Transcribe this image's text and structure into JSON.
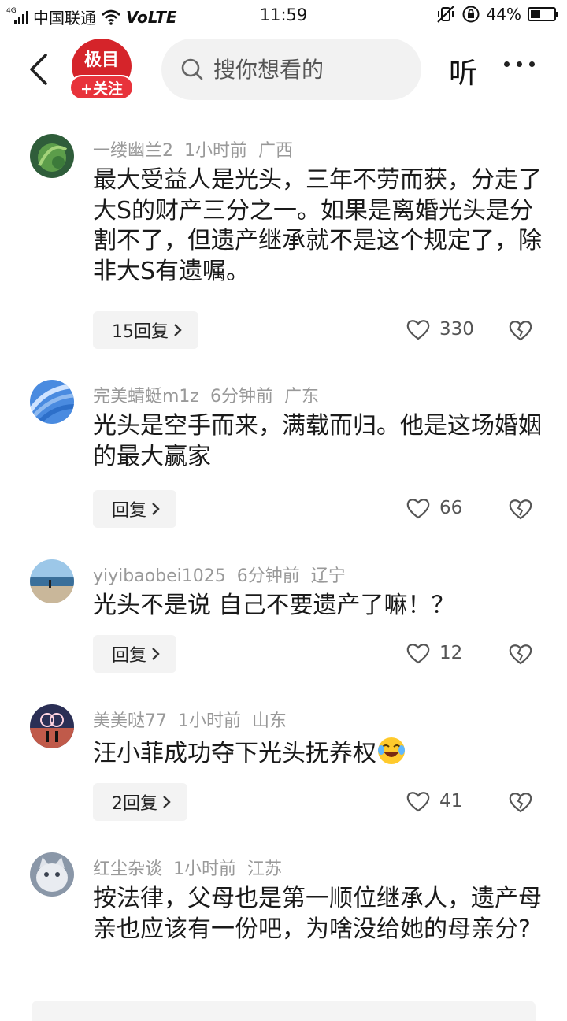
{
  "status_bar": {
    "network_type": "4G",
    "carrier": "中国联通",
    "volte": "VoLTE",
    "time": "11:59",
    "battery_percent": "44%",
    "battery_level": 0.44
  },
  "header": {
    "logo_text": "极目",
    "follow_label": "+关注",
    "search_placeholder": "搜你想看的",
    "listen_label": "听"
  },
  "comments": [
    {
      "username": "一缕幽兰2",
      "time": "1小时前",
      "location": "广西",
      "text": "最大受益人是光头，三年不劳而获，分走了大S的财产三分之一。如果是离婚光头是分割不了，但遗产继承就不是这个规定了，除非大S有遗嘱。",
      "reply_label": "15回复",
      "likes": "330",
      "avatar_icon": "leaf-avatar"
    },
    {
      "username": "完美蜻蜓m1z",
      "time": "6分钟前",
      "location": "广东",
      "text": "光头是空手而来，满载而归。他是这场婚姻的最大赢家",
      "reply_label": "回复",
      "likes": "66",
      "avatar_icon": "blue-swirl-avatar"
    },
    {
      "username": "yiyibaobei1025",
      "time": "6分钟前",
      "location": "辽宁",
      "text": "光头不是说 自己不要遗产了嘛！？",
      "reply_label": "回复",
      "likes": "12",
      "avatar_icon": "beach-avatar"
    },
    {
      "username": "美美哒77",
      "time": "1小时前",
      "location": "山东",
      "text": "汪小菲成功夺下光头抚养权",
      "reply_label": "2回复",
      "likes": "41",
      "avatar_icon": "couple-sunset-avatar",
      "emoji": "laughing-crying-emoji"
    },
    {
      "username": "红尘杂谈",
      "time": "1小时前",
      "location": "江苏",
      "text": "按法律，父母也是第一顺位继承人，遗产母亲也应该有一份吧，为啥没给她的母亲分?",
      "avatar_icon": "cat-avatar"
    }
  ],
  "icons": {
    "reply_chevron": "chevron-right-icon",
    "like": "heart-icon",
    "dislike": "broken-heart-icon"
  },
  "colors": {
    "accent_red": "#d5242a",
    "meta_gray": "#999999",
    "button_bg": "#f3f3f3"
  }
}
